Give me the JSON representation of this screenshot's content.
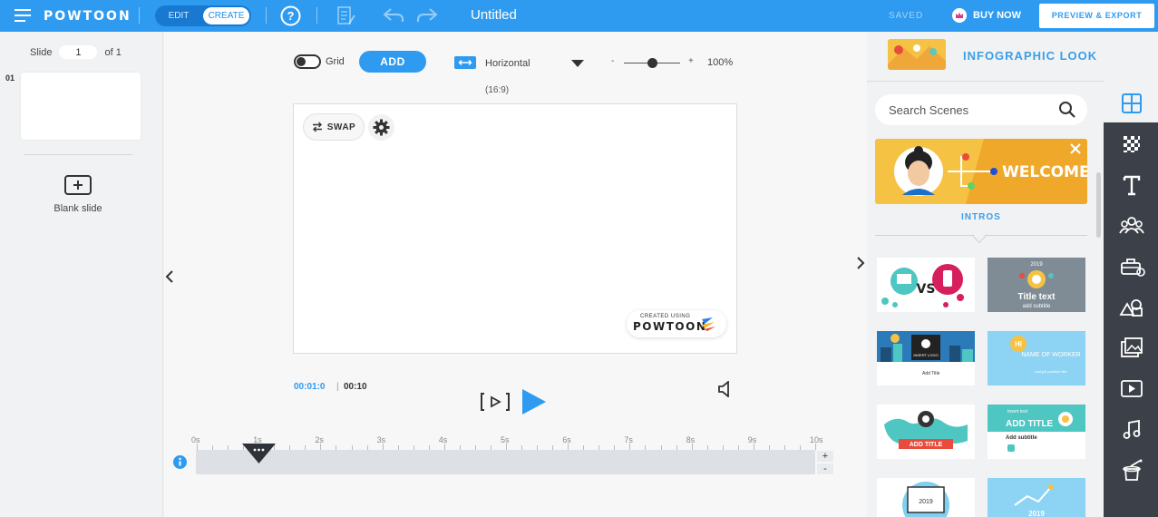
{
  "header": {
    "logo": "POWTOON",
    "mode_edit": "EDIT",
    "mode_create": "CREATE",
    "doc_title": "Untitled",
    "saved": "SAVED",
    "buy_now": "BUY NOW",
    "preview_export": "PREVIEW & EXPORT"
  },
  "slides_panel": {
    "slide_label": "Slide",
    "current_slide": "1",
    "of_label": "of 1",
    "slide_index": "01",
    "blank_slide": "Blank slide"
  },
  "toolbar": {
    "grid_label": "Grid",
    "add_label": "ADD",
    "orientation": "Horizontal",
    "ratio": "(16:9)",
    "zoom_minus": "-",
    "zoom_plus": "+",
    "zoom_value": "100%",
    "zoom_level": 0.5
  },
  "stage": {
    "swap_label": "SWAP",
    "watermark_small": "CREATED USING",
    "watermark_big": "POWTOON"
  },
  "playback": {
    "current_time": "00:01:0",
    "separator": "|",
    "total_time": "00:10"
  },
  "timeline": {
    "ticks": [
      "0s",
      "1s",
      "2s",
      "3s",
      "4s",
      "5s",
      "6s",
      "7s",
      "8s",
      "9s",
      "10s"
    ],
    "playhead_seconds": 1,
    "zoom_in": "+",
    "zoom_out": "-"
  },
  "right_panel": {
    "look_label": "INFOGRAPHIC LOOK",
    "search_placeholder": "Search Scenes",
    "banner_text": "WELCOME",
    "section_label": "INTROS",
    "scenes": [
      {
        "text": "VS"
      },
      {
        "text": "Title text",
        "year": "2019",
        "subtitle": "add subtitle"
      },
      {
        "text": "INSERT LOGO",
        "subtitle": "Add Title"
      },
      {
        "text": "NAME OF WORKER",
        "subtitle": "add job position title"
      },
      {
        "text": "ADD TITLE"
      },
      {
        "text": "ADD TITLE",
        "small": "Insert text",
        "subtitle": "Add subtitle"
      },
      {
        "text": "2019"
      },
      {
        "text": "2019"
      }
    ]
  },
  "colors": {
    "accent": "#2e9bf0",
    "rail": "#3c4149",
    "banner": "#f6c244"
  }
}
